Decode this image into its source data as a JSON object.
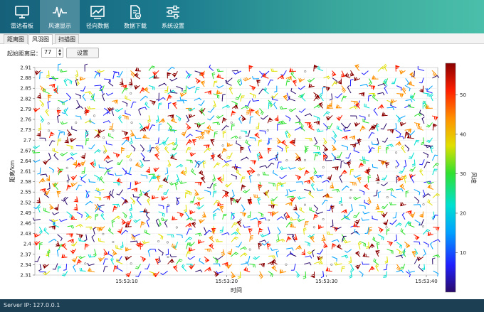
{
  "nav": [
    {
      "label": "雷达看板",
      "icon": "monitor-icon"
    },
    {
      "label": "风速显示",
      "icon": "waveform-icon"
    },
    {
      "label": "径向数据",
      "icon": "line-chart-icon"
    },
    {
      "label": "数据下载",
      "icon": "download-document-icon"
    },
    {
      "label": "系统设置",
      "icon": "sliders-icon"
    }
  ],
  "tabs": [
    "距离图",
    "风羽图",
    "扫描图"
  ],
  "controls": {
    "start_label": "起始距离层：",
    "start_value": "77",
    "set_button": "设置"
  },
  "status": {
    "server_ip": "Server IP: 127.0.0.1"
  },
  "chart_data": {
    "type": "scatter",
    "title": "",
    "xlabel": "时间",
    "ylabel": "距离/km",
    "colorbar_label": "风速",
    "x_tick_labels": [
      "15:53:10",
      "15:53:20",
      "15:53:30",
      "15:53:40"
    ],
    "y_tick_labels": [
      "2.31",
      "2.34",
      "2.37",
      "2.4",
      "2.43",
      "2.46",
      "2.49",
      "2.52",
      "2.55",
      "2.58",
      "2.61",
      "2.64",
      "2.67",
      "2.7",
      "2.73",
      "2.76",
      "2.79",
      "2.82",
      "2.85",
      "2.88",
      "2.91"
    ],
    "ylim": [
      2.31,
      2.91
    ],
    "colorbar_ticks": [
      10,
      20,
      30,
      40,
      50
    ],
    "colorbar_range": [
      0,
      58
    ],
    "colormap": [
      "#2a0a6a",
      "#2020ff",
      "#00a0ff",
      "#00e0d0",
      "#30e030",
      "#e0e000",
      "#ff9000",
      "#ff2000",
      "#8a0000"
    ],
    "marker": "wind-barb",
    "series_note": "wind barbs at each time/height cell; speed shown by color"
  }
}
